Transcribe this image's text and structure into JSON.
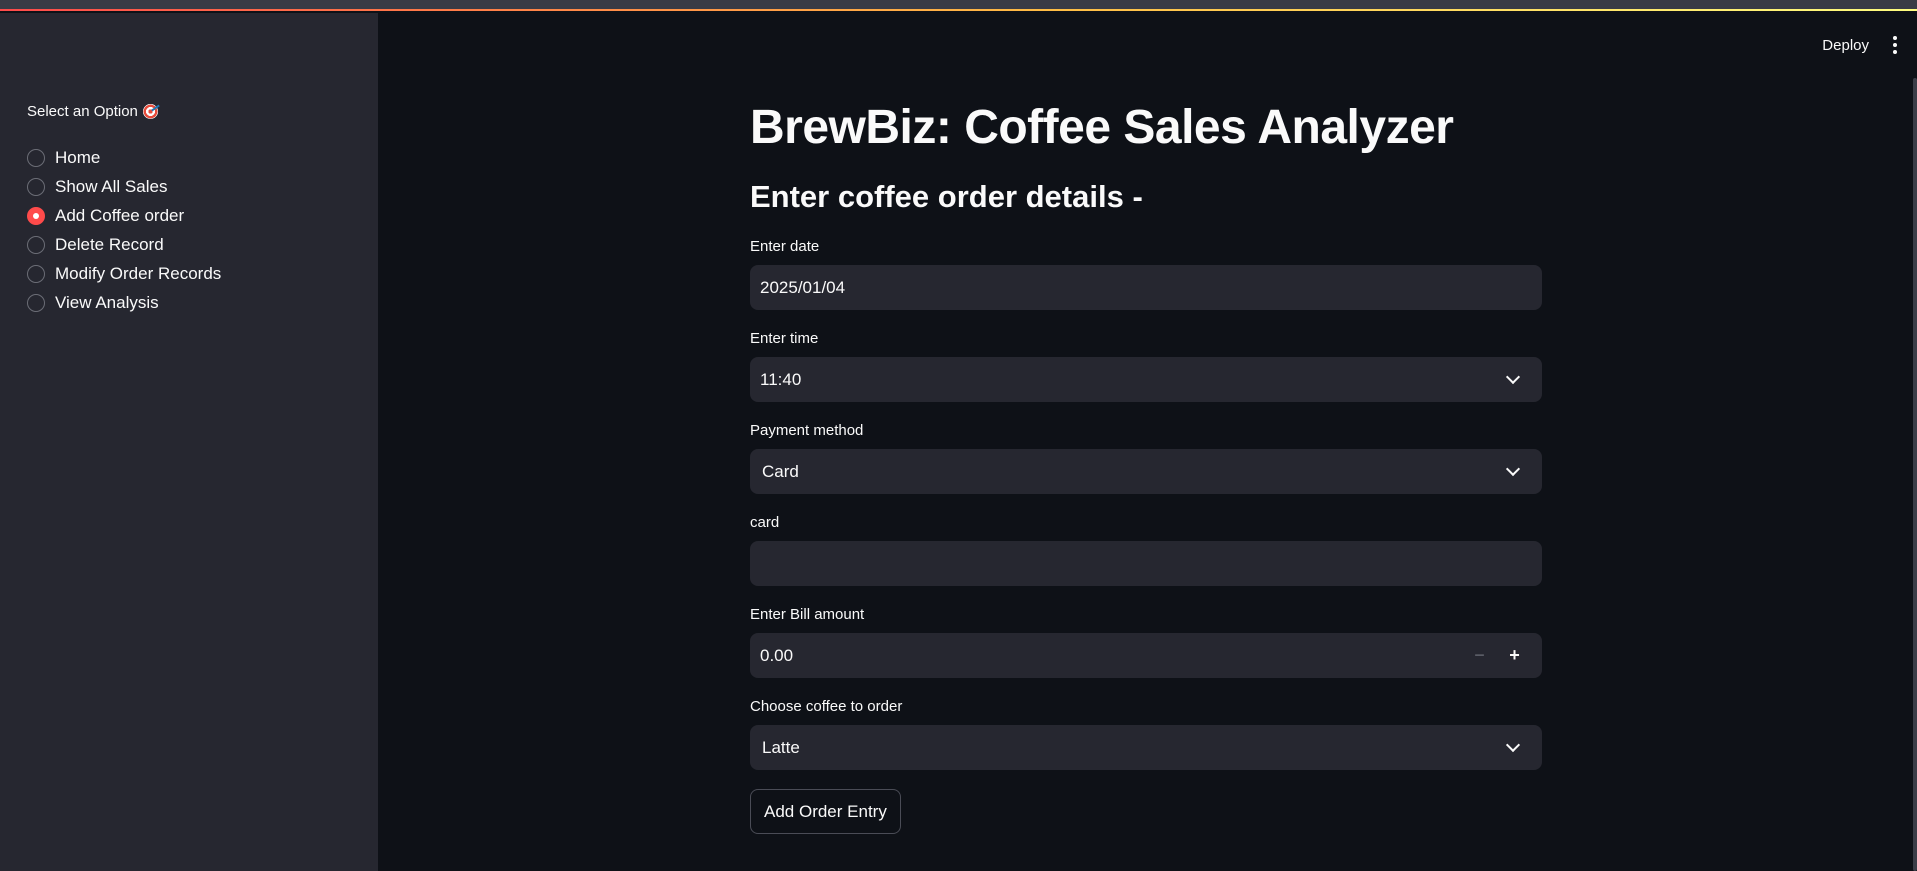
{
  "header": {
    "deploy_label": "Deploy"
  },
  "sidebar": {
    "label": "Select an Option",
    "options": [
      {
        "label": "Home",
        "checked": false
      },
      {
        "label": "Show All Sales",
        "checked": false
      },
      {
        "label": "Add Coffee order",
        "checked": true
      },
      {
        "label": "Delete Record",
        "checked": false
      },
      {
        "label": "Modify Order Records",
        "checked": false
      },
      {
        "label": "View Analysis",
        "checked": false
      }
    ]
  },
  "main": {
    "title": "BrewBiz: Coffee Sales Analyzer",
    "subtitle": "Enter coffee order details -",
    "date": {
      "label": "Enter date",
      "value": "2025/01/04"
    },
    "time": {
      "label": "Enter time",
      "value": "11:40"
    },
    "payment": {
      "label": "Payment method",
      "value": "Card"
    },
    "card": {
      "label": "card",
      "value": ""
    },
    "bill": {
      "label": "Enter Bill amount",
      "value": "0.00",
      "minus": "−",
      "plus": "+"
    },
    "coffee": {
      "label": "Choose coffee to order",
      "value": "Latte"
    },
    "submit_label": "Add Order Entry"
  },
  "colors": {
    "accent": "#ff4b4b",
    "background": "#0e1117",
    "sidebar": "#262730",
    "input": "#262730"
  }
}
